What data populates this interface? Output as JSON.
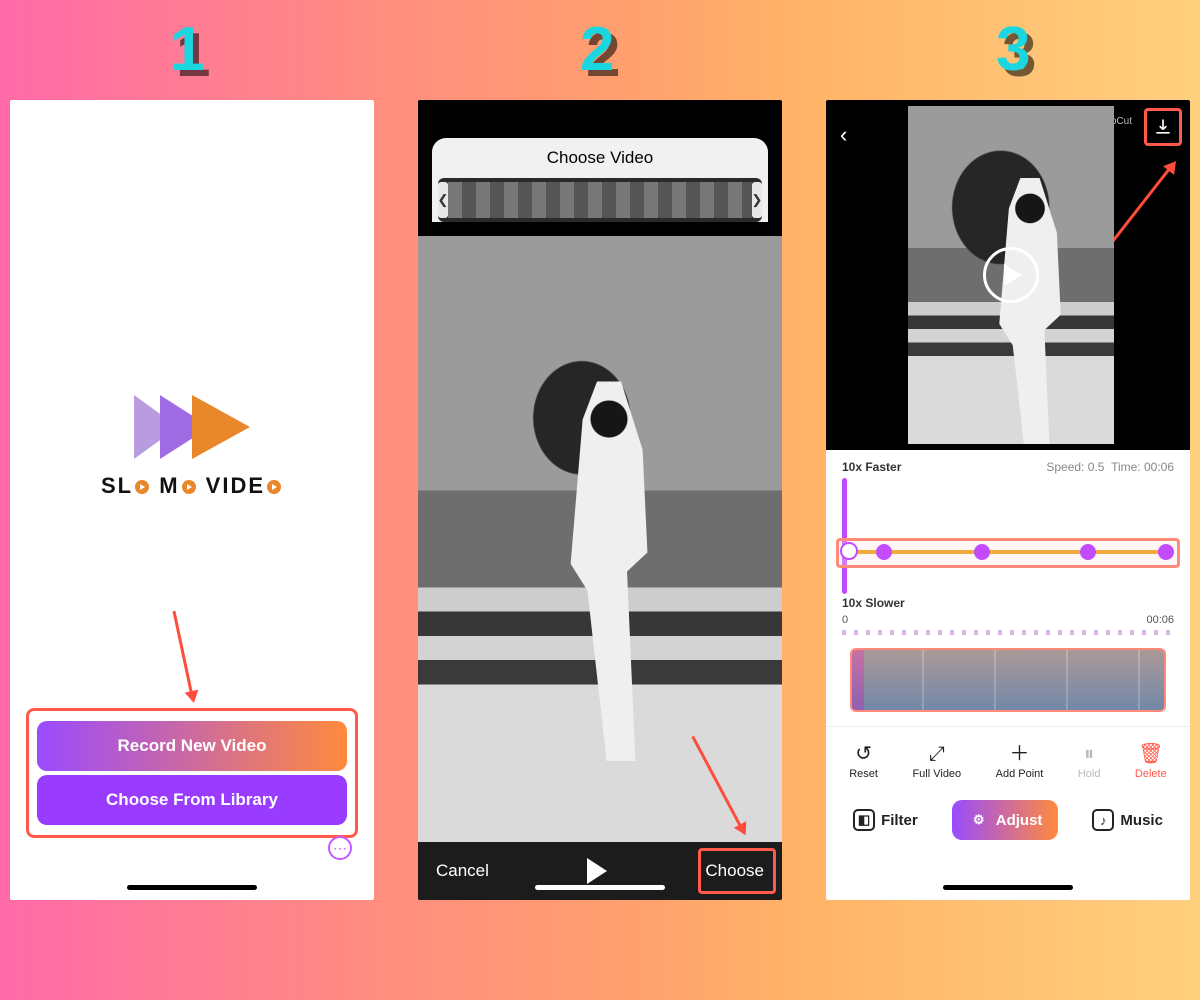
{
  "steps": {
    "one": "1",
    "two": "2",
    "three": "3"
  },
  "screen1": {
    "brand_text": "SL   M   VIDE",
    "brand_full": "SLO MO VIDEO",
    "record_btn": "Record New Video",
    "library_btn": "Choose From Library"
  },
  "screen2": {
    "title": "Choose Video",
    "cancel": "Cancel",
    "choose": "Choose"
  },
  "screen3": {
    "capcut": "✂ CapCut",
    "faster_label": "10x Faster",
    "speed_label": "Speed: 0.5",
    "time_label": "Time: 00:06",
    "slower_label": "10x Slower",
    "timeline_start": "0",
    "timeline_end": "00:06",
    "tools": {
      "reset": "Reset",
      "full": "Full Video",
      "add": "Add Point",
      "hold": "Hold",
      "delete": "Delete"
    },
    "tabs": {
      "filter": "Filter",
      "adjust": "Adjust",
      "music": "Music"
    }
  }
}
